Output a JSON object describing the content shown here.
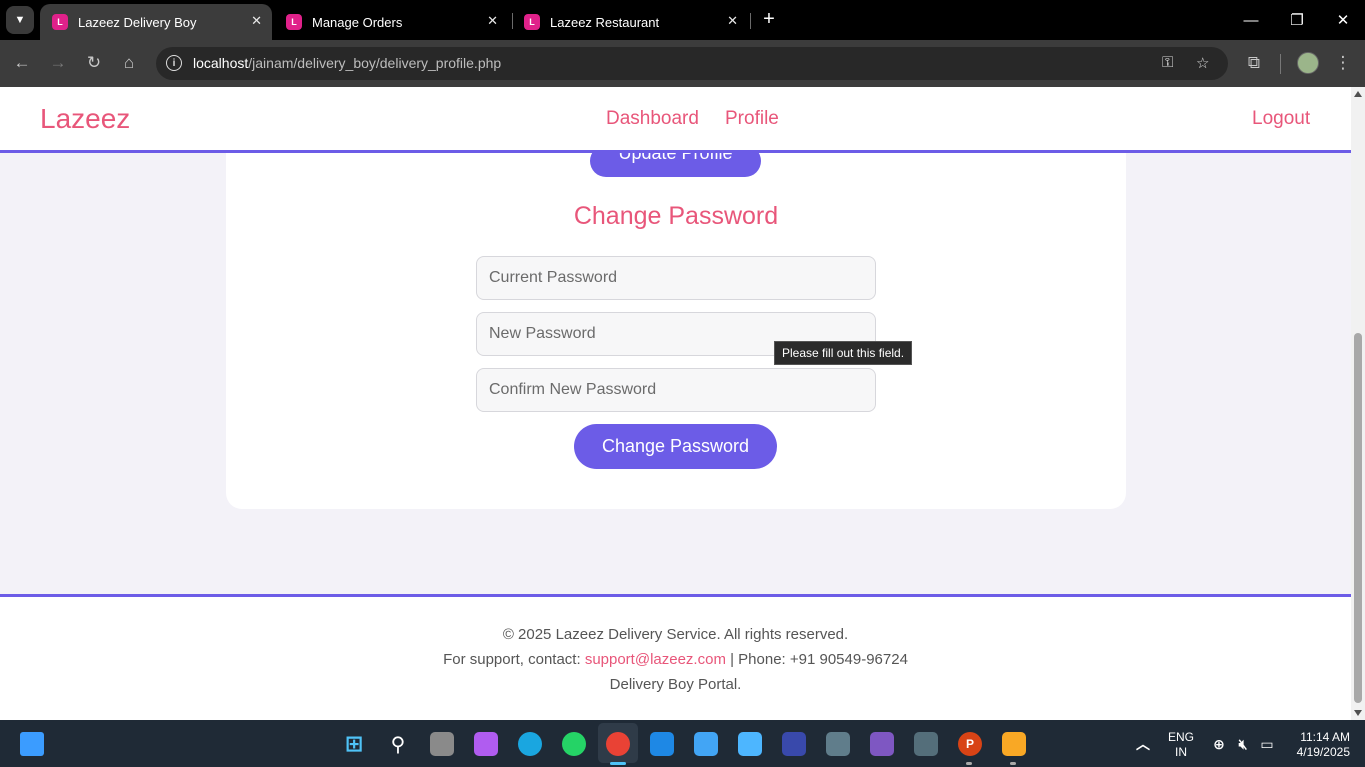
{
  "browser": {
    "tabs": [
      {
        "title": "Lazeez Delivery Boy",
        "active": true
      },
      {
        "title": "Manage Orders",
        "active": false
      },
      {
        "title": "Lazeez Restaurant",
        "active": false
      }
    ],
    "url_host": "localhost",
    "url_path": "/jainam/delivery_boy/delivery_profile.php"
  },
  "navbar": {
    "brand": "Lazeez",
    "links": [
      "Dashboard",
      "Profile"
    ],
    "logout": "Logout"
  },
  "profile": {
    "update_button": "Update Profile"
  },
  "change_password": {
    "title": "Change Password",
    "fields": [
      {
        "placeholder": "Current Password",
        "value": ""
      },
      {
        "placeholder": "New Password",
        "value": ""
      },
      {
        "placeholder": "Confirm New Password",
        "value": ""
      }
    ],
    "submit": "Change Password",
    "tooltip": "Please fill out this field."
  },
  "footer": {
    "copyright": "© 2025 Lazeez Delivery Service. All rights reserved.",
    "support_prefix": "For support, contact:",
    "support_email": "support@lazeez.com",
    "support_phone": "| Phone: +91 90549-96724",
    "portal": "Delivery Boy Portal."
  },
  "taskbar": {
    "language": "ENG",
    "region": "IN",
    "time": "11:14 AM",
    "date": "4/19/2025",
    "apps": [
      "start-icon",
      "search-icon",
      "task-view-icon",
      "copilot-icon",
      "edge-icon",
      "whatsapp-icon",
      "chrome-icon",
      "vscode-icon",
      "notepad-icon",
      "store-icon",
      "app-icon",
      "remote-desktop-icon",
      "visual-studio-icon",
      "terminal-icon",
      "powerpoint-icon",
      "file-explorer-icon"
    ]
  },
  "colors": {
    "accent": "#6c5ce7",
    "brand_pink": "#e8567a"
  }
}
